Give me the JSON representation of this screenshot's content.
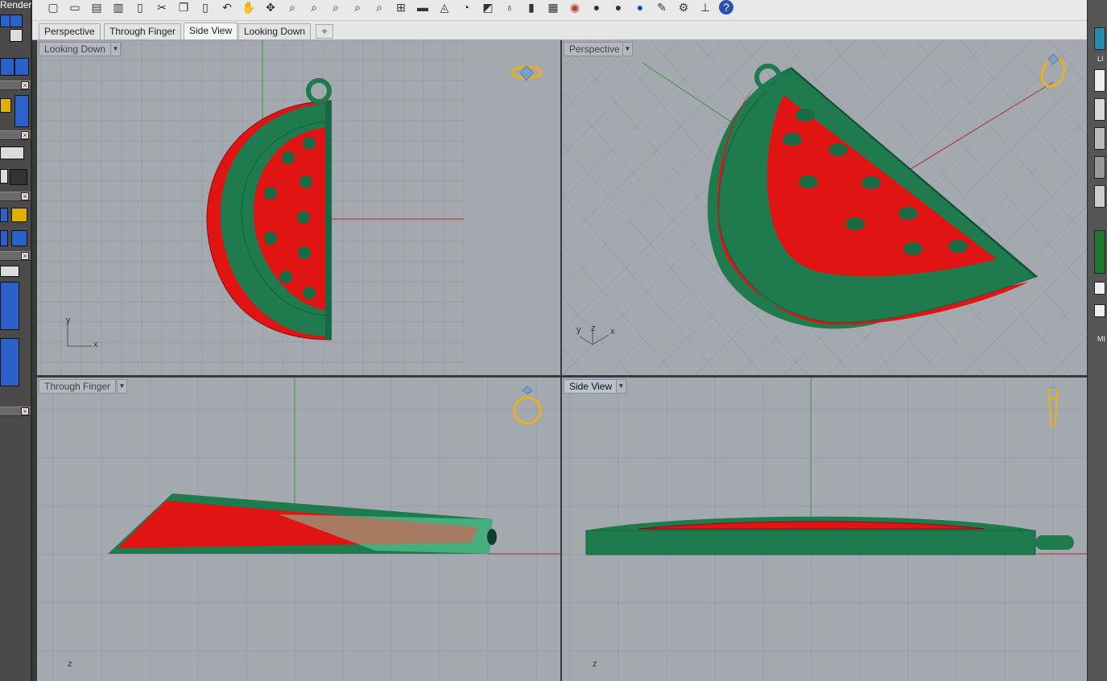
{
  "app": {
    "render_label": "Render"
  },
  "toolbar": {
    "icons": [
      "new-file-icon",
      "open-icon",
      "save-icon",
      "print-icon",
      "template-icon",
      "cut-icon",
      "copy-icon",
      "paste-icon",
      "undo-icon",
      "pan-icon",
      "rotate-icon",
      "zoom-icon",
      "zoom-window-icon",
      "zoom-extents-icon",
      "zoom-selected-icon",
      "zoom-dynamic-icon",
      "four-viewports-icon",
      "car-icon",
      "ruler-icon",
      "clock-icon",
      "snap-icon",
      "light-icon",
      "lock-icon",
      "layers-icon",
      "color-wheel-icon",
      "sphere-icon",
      "sphere-shaded-icon",
      "blue-sphere-icon",
      "pencil-icon",
      "gear-icon",
      "dimension-icon",
      "help-icon"
    ]
  },
  "tabs": [
    {
      "label": "Perspective",
      "active": false
    },
    {
      "label": "Through Finger",
      "active": false
    },
    {
      "label": "Side View",
      "active": true
    },
    {
      "label": "Looking Down",
      "active": false
    }
  ],
  "viewports": {
    "top_left": {
      "label": "Looking Down",
      "axis_x": "x",
      "axis_y": "y"
    },
    "top_right": {
      "label": "Perspective",
      "axis_x": "x",
      "axis_y": "y",
      "axis_z": "z"
    },
    "bottom_left": {
      "label": "Through Finger",
      "axis_z": "z"
    },
    "bottom_right": {
      "label": "Side View",
      "axis_z": "z"
    }
  },
  "colors": {
    "rind": "#1f7a4e",
    "flesh": "#e11414",
    "seed": "#1c6a44",
    "grid": "#9aa0a7",
    "viewport_bg": "#a4a9b0",
    "x_axis": "#b03030",
    "y_axis": "#3a9a3a",
    "gizmo": "#e8b020"
  },
  "right_panel": {
    "label_li": "LI",
    "label_mi": "MI"
  }
}
